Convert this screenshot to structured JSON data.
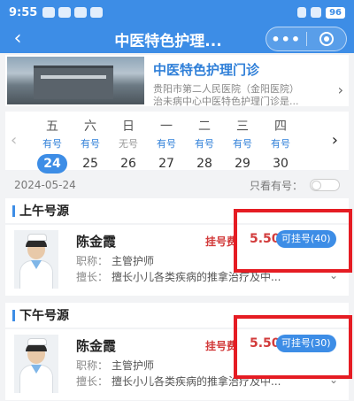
{
  "status_bar": {
    "time": "9:55",
    "battery": "96"
  },
  "nav": {
    "back_icon": "‹",
    "title": "中医特色护理...",
    "more_icon": "•••"
  },
  "clinic": {
    "name": "中医特色护理门诊",
    "address_line1": "贵阳市第二人民医院（金阳医院）",
    "address_line2": "治未病中心中医特色护理门诊是...",
    "arrow": "›"
  },
  "date_selector": {
    "prev_arrow": "‹",
    "next_arrow": "›",
    "days": [
      {
        "weekday": "五",
        "status": "有号",
        "date": "24",
        "selected": true
      },
      {
        "weekday": "六",
        "status": "有号",
        "date": "25",
        "selected": false
      },
      {
        "weekday": "日",
        "status": "无号",
        "date": "26",
        "selected": false
      },
      {
        "weekday": "一",
        "status": "有号",
        "date": "27",
        "selected": false
      },
      {
        "weekday": "二",
        "status": "有号",
        "date": "28",
        "selected": false
      },
      {
        "weekday": "三",
        "status": "有号",
        "date": "29",
        "selected": false
      },
      {
        "weekday": "四",
        "status": "有号",
        "date": "30",
        "selected": false
      }
    ]
  },
  "filter": {
    "date": "2024-05-24",
    "only_available_label": "只看有号："
  },
  "morning": {
    "title": "上午号源",
    "doctor": {
      "name": "陈金霞",
      "fee_label": "挂号费",
      "fee": "5.50",
      "book_label": "可挂号(40)",
      "title_key": "职称：",
      "title_value": "主管护师",
      "specialty_key": "擅长：",
      "specialty_value": "擅长小儿各类疾病的推拿治疗及中...",
      "expand_icon": "⌄"
    }
  },
  "afternoon": {
    "title": "下午号源",
    "doctor": {
      "name": "陈金霞",
      "fee_label": "挂号费",
      "fee": "5.50",
      "book_label": "可挂号(30)",
      "title_key": "职称：",
      "title_value": "主管护师",
      "specialty_key": "擅长：",
      "specialty_value": "擅长小儿各类疾病的推拿治疗及中...",
      "expand_icon": "⌄"
    }
  },
  "colors": {
    "primary": "#3d8de6",
    "fee": "#d23b3b",
    "highlight_box": "#e51c23"
  }
}
